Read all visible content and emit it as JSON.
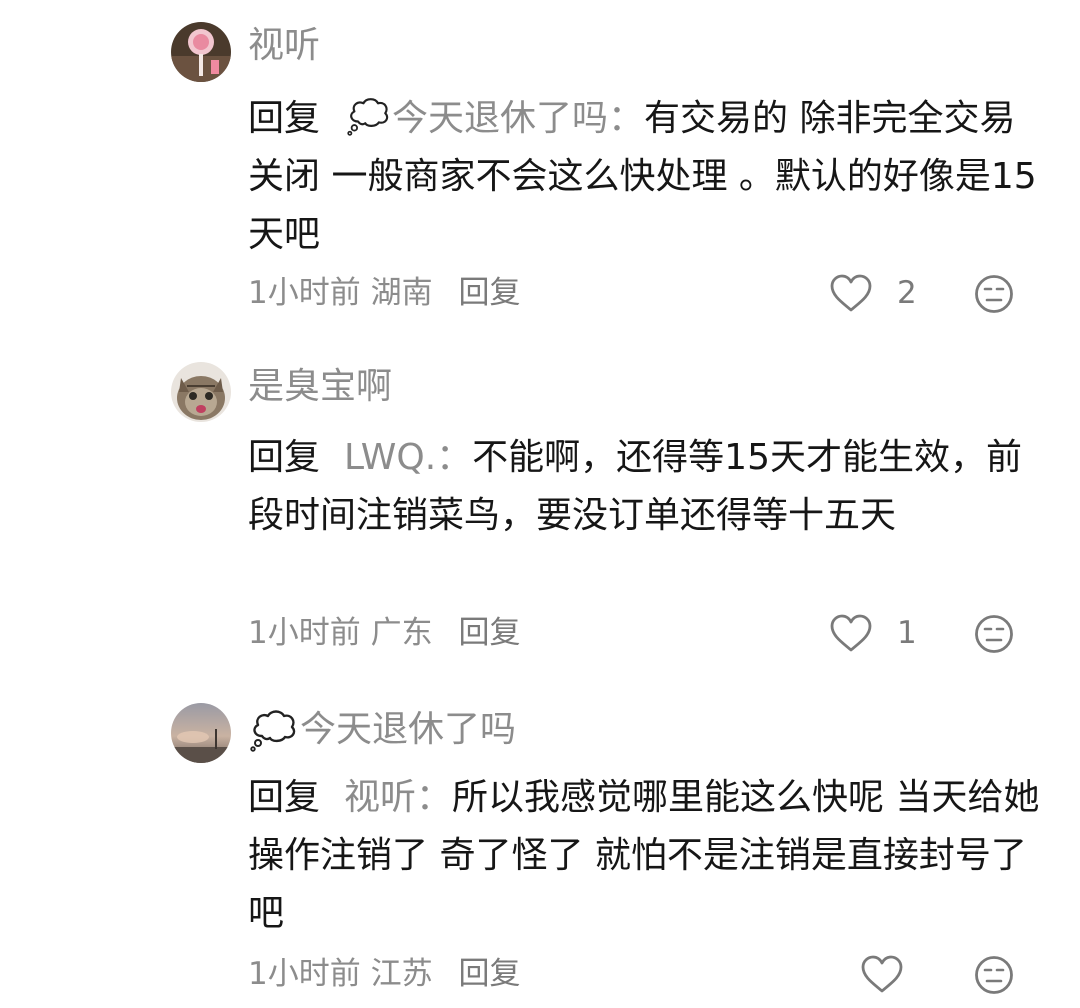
{
  "comments": [
    {
      "username": "视听",
      "reply_label": "回复",
      "reply_to": "今天退休了吗",
      "reply_colon": "：",
      "text": "有交易的 除非完全交易关闭 一般商家不会这么快处理 。默认的好像是15天吧",
      "time": "1小时前",
      "location": "湖南",
      "reply_button": "回复",
      "likes": "2"
    },
    {
      "username": "是臭宝啊",
      "reply_label": "回复",
      "reply_to": "LWQ.",
      "reply_colon": "：",
      "text": "不能啊，还得等15天才能生效，前段时间注销菜鸟，要没订单还得等十五天",
      "time": "1小时前",
      "location": "广东",
      "reply_button": "回复",
      "likes": "1"
    },
    {
      "username": "今天退休了吗",
      "reply_label": "回复",
      "reply_to": "视听",
      "reply_colon": "：",
      "text": "所以我感觉哪里能这么快呢 当天给她操作注销了 奇了怪了 就怕不是注销是直接封号了吧",
      "time": "1小时前",
      "location": "江苏",
      "reply_button": "回复",
      "likes": ""
    }
  ],
  "icons": {
    "like": "heart-outline-icon",
    "dislike": "neutral-face-icon",
    "username_badge": "thought-bubble-icon"
  },
  "colors": {
    "text_primary": "#161616",
    "text_secondary": "#8c8c8c",
    "icon_gray": "#7a7a7a"
  }
}
